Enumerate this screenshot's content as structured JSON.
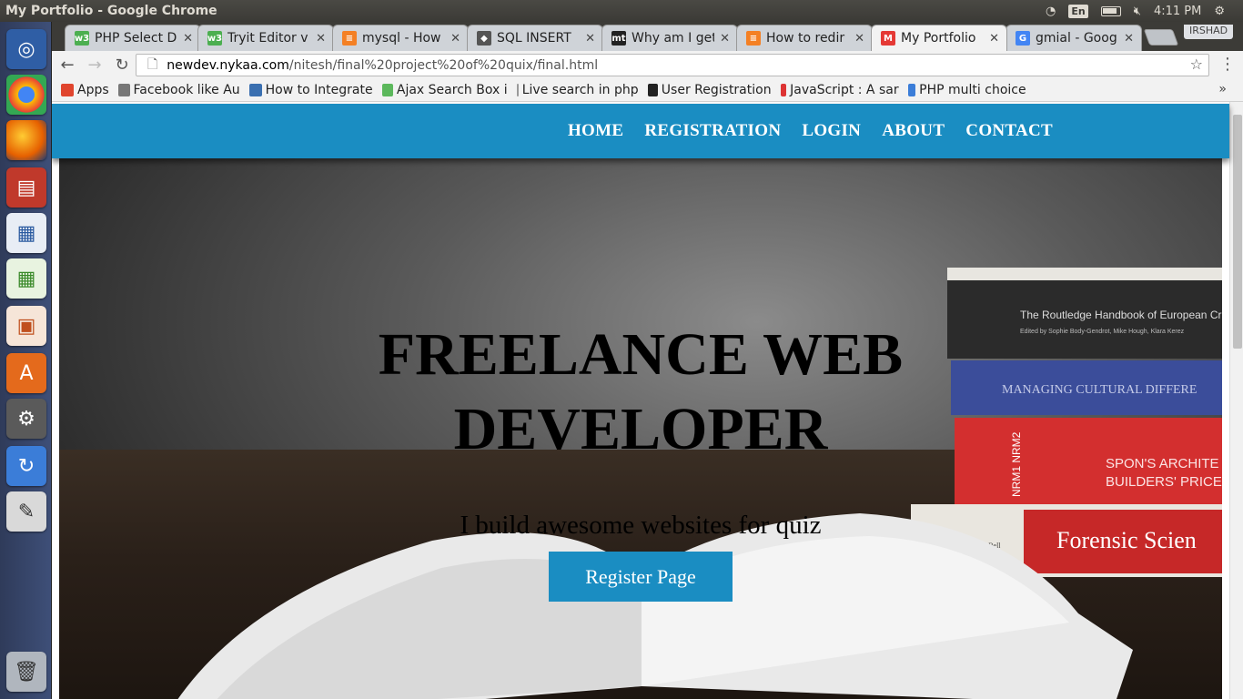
{
  "os": {
    "window_title": "My Portfolio - Google Chrome",
    "keyboard": "En",
    "time": "4:11 PM",
    "profile_badge": "IRSHAD"
  },
  "tabs": [
    {
      "label": "PHP Select D",
      "icon": "w3schools-icon",
      "color": "#4caf50"
    },
    {
      "label": "Tryit Editor v",
      "icon": "w3schools-icon",
      "color": "#4caf50"
    },
    {
      "label": "mysql - How",
      "icon": "stackoverflow-icon",
      "color": "#f48024"
    },
    {
      "label": "SQL INSERT",
      "icon": "diamond-icon",
      "color": "#555555"
    },
    {
      "label": "Why am I get",
      "icon": "mt-icon",
      "color": "#222222"
    },
    {
      "label": "How to redir",
      "icon": "stackoverflow-icon",
      "color": "#f48024"
    },
    {
      "label": "My Portfolio",
      "icon": "portfolio-icon",
      "color": "#e53935",
      "active": true
    },
    {
      "label": "gmial - Goog",
      "icon": "google-icon",
      "color": "#4285f4"
    }
  ],
  "toolbar": {
    "url_host": "newdev.nykaa.com",
    "url_path": "/nitesh/final%20project%20of%20quix/final.html"
  },
  "bookmarks": [
    {
      "label": "Apps",
      "icon": "apps-grid-icon"
    },
    {
      "label": "Facebook like Au",
      "icon": "doc-icon"
    },
    {
      "label": "How to Integrate",
      "icon": "integrate-icon"
    },
    {
      "label": "Ajax Search Box i",
      "icon": "hexagon-icon"
    },
    {
      "label": "Live search in php",
      "icon": "page-icon"
    },
    {
      "label": "User Registration",
      "icon": "quote-icon"
    },
    {
      "label": "JavaScript : A sar",
      "icon": "js-icon"
    },
    {
      "label": "PHP multi choice",
      "icon": "php-icon"
    }
  ],
  "site": {
    "nav": [
      "HOME",
      "REGISTRATION",
      "LOGIN",
      "ABOUT",
      "CONTACT"
    ],
    "hero_title": "FREELANCE WEB DEVELOPER",
    "hero_subtitle": "I build awesome websites for quiz",
    "hero_button": "Register Page",
    "accent": "#1a8dc2"
  },
  "books": [
    {
      "title": "The Routledge Handbook of European Cri",
      "subtitle": "Edited by Sophie Body-Gendrot, Mike Hough, Klara Kerez",
      "color": "#2b2b2b"
    },
    {
      "title": "MANAGING CULTURAL DIFFERE",
      "color": "#3b4d9a"
    },
    {
      "title": "SPON'S ARCHITE BUILDERS' PRICE",
      "spine": "NRM1 NRM2",
      "color": "#d32f2f"
    },
    {
      "title": "Forensic Scien",
      "spine": "James | Nordby | Bell",
      "color": "#c62828"
    }
  ]
}
